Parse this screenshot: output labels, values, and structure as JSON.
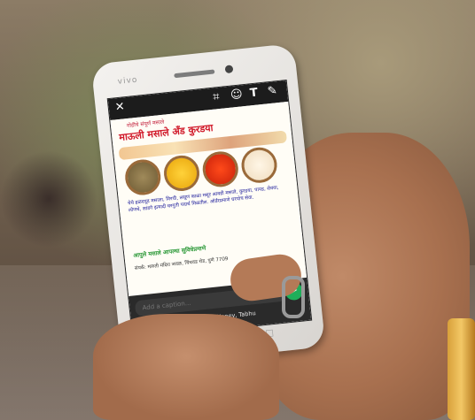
{
  "scene": {
    "description_colors": {
      "skin": "#b47a57",
      "phone_body": "#f2f0ed",
      "bangle": "#e0a83d"
    }
  },
  "phone": {
    "brand": "vivo",
    "editor_toolbar": {
      "icons": [
        "close-icon",
        "crop-icon",
        "emoji-icon",
        "text-icon",
        "pen-icon"
      ],
      "close_glyph": "✕",
      "crop_glyph": "⌗",
      "emoji_glyph": "☺",
      "text_glyph": "T",
      "pen_glyph": "✎"
    },
    "poster": {
      "tagline": "गोडीचे संपूर्ण मसाले",
      "shop_name": "माऊली मसाले अँड कुरडया",
      "description": "येथे हळदपूड मसाला, मिरची, लसूण काळा मसूर आवडी मसाले, कुरडया, पापड, शेवया, लोणचे, सांडगे इत्यादी घरगुती पदार्थ मिळतील. ऑर्डरप्रमाणे घरपोच सेवा.",
      "highlight": "आपुले मसाले आपल्या सुविधेप्रमाणे",
      "address": "संपर्क: मारुती मंदिरा जवळ, चिंचवड रोड, पुणे",
      "phone": "7709"
    },
    "caption": {
      "placeholder": "Add a caption...",
      "send_glyph": "➤",
      "recipient": "› Swetch Passion Creation, Honey, Tabhu"
    },
    "nav_glyphs": [
      "◁",
      "○",
      "□"
    ]
  }
}
